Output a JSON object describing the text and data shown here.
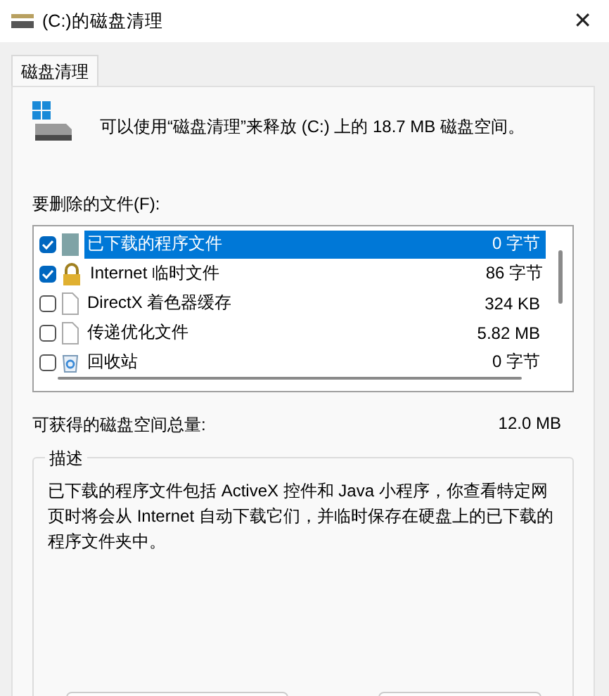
{
  "window": {
    "title": "(C:)的磁盘清理",
    "close": "✕"
  },
  "tabs": [
    {
      "label": "磁盘清理",
      "selected": true
    }
  ],
  "intro": "可以使用“磁盘清理”来释放  (C:) 上的 18.7 MB 磁盘空间。",
  "files_label": "要删除的文件(F):",
  "files": [
    {
      "kind": "program",
      "name": "已下载的程序文件",
      "size": "0 字节",
      "checked": true,
      "selected": true
    },
    {
      "kind": "lock",
      "name": "Internet 临时文件",
      "size": "86 字节",
      "checked": true,
      "selected": false
    },
    {
      "kind": "file",
      "name": "DirectX 着色器缓存",
      "size": "324 KB",
      "checked": false,
      "selected": false
    },
    {
      "kind": "file",
      "name": "传递优化文件",
      "size": "5.82 MB",
      "checked": false,
      "selected": false
    },
    {
      "kind": "recycle",
      "name": "回收站",
      "size": "0 字节",
      "checked": false,
      "selected": false
    }
  ],
  "total": {
    "label": "可获得的磁盘空间总量:",
    "value": "12.0 MB"
  },
  "description": {
    "legend": "描述",
    "text": "已下载的程序文件包括 ActiveX 控件和 Java 小程序，你查看特定网页时将会从 Internet 自动下载它们，并临时保存在硬盘上的已下载的程序文件夹中。"
  }
}
